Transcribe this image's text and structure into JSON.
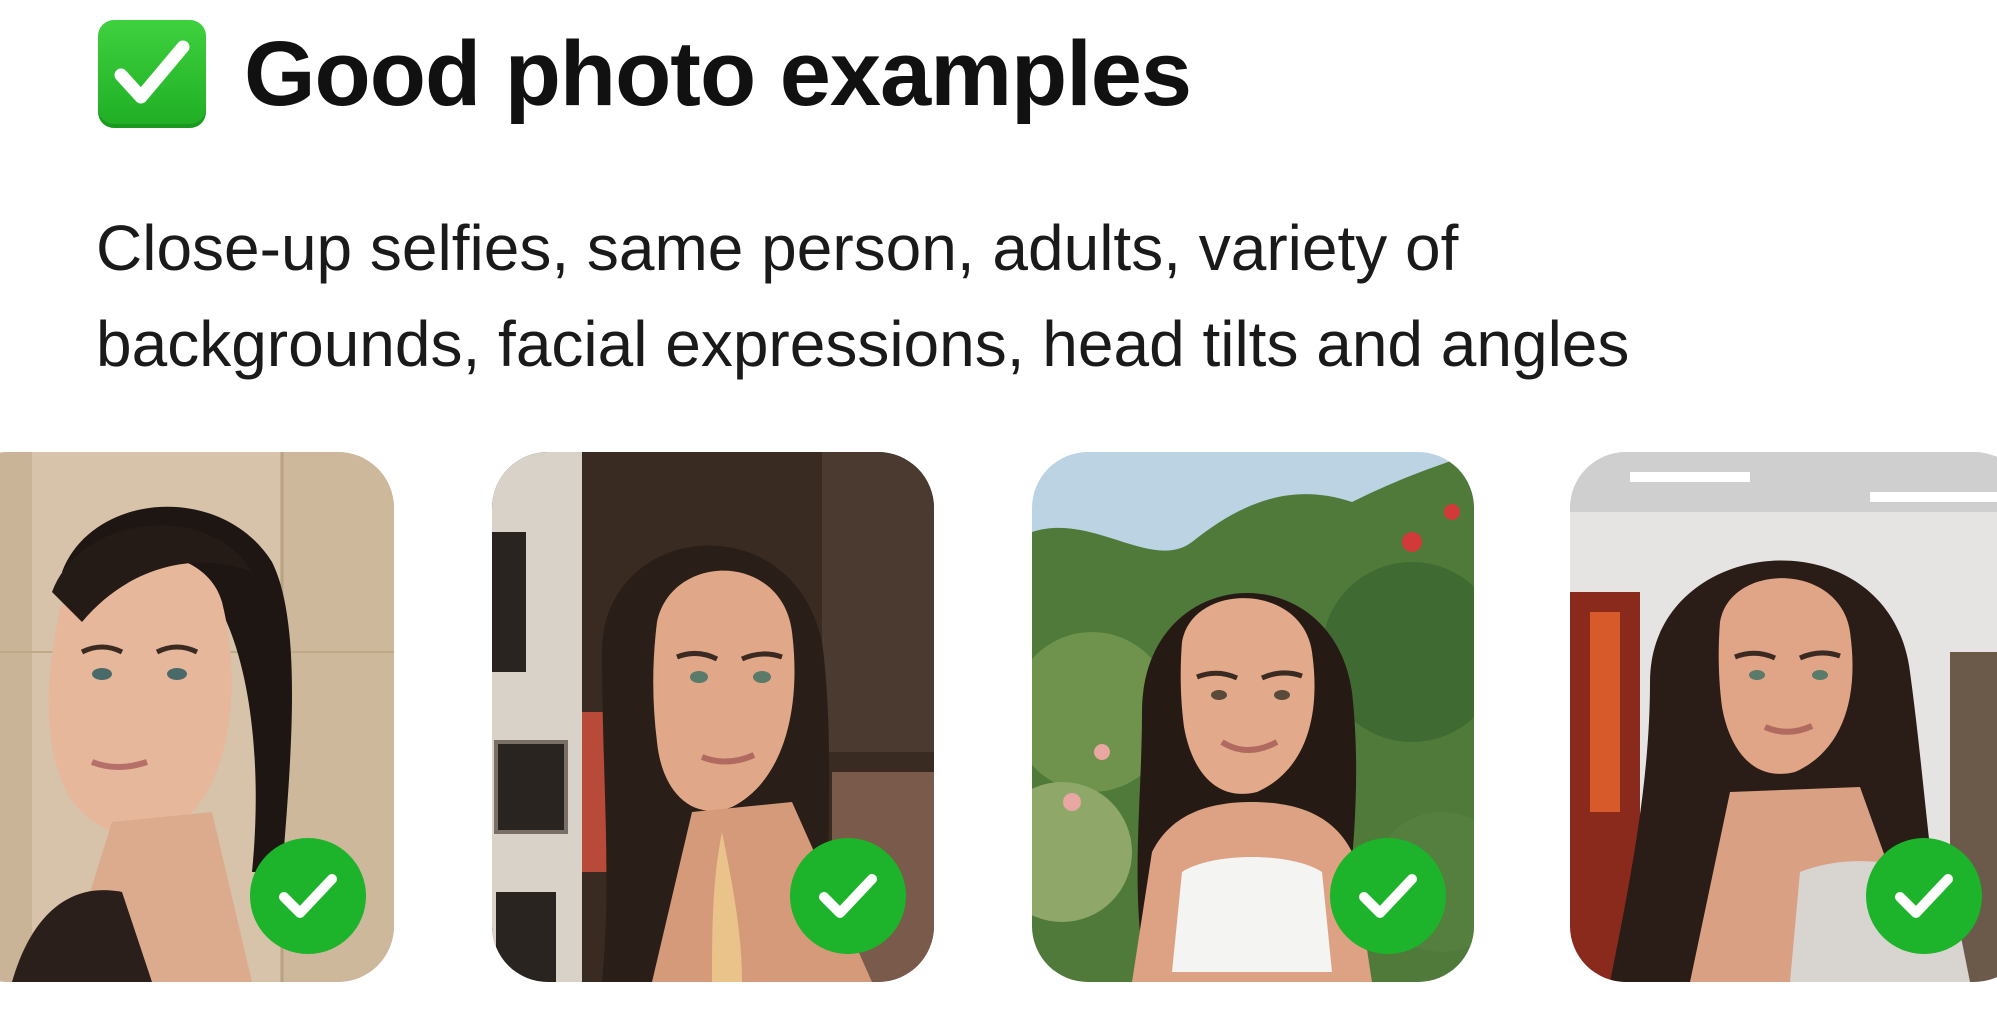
{
  "header": {
    "title": "Good photo examples",
    "icon": "check-mark-button-icon",
    "icon_color": "#22b52a"
  },
  "description": {
    "line1": "Close-up selfies, same person, adults, variety of",
    "line2": "backgrounds, facial expressions, head tilts and angles"
  },
  "examples": [
    {
      "name": "example-photo-1",
      "status_icon": "check-circle-icon"
    },
    {
      "name": "example-photo-2",
      "status_icon": "check-circle-icon"
    },
    {
      "name": "example-photo-3",
      "status_icon": "check-circle-icon"
    },
    {
      "name": "example-photo-4",
      "status_icon": "check-circle-icon"
    }
  ],
  "colors": {
    "badge_green": "#1db32a",
    "text": "#111111"
  }
}
